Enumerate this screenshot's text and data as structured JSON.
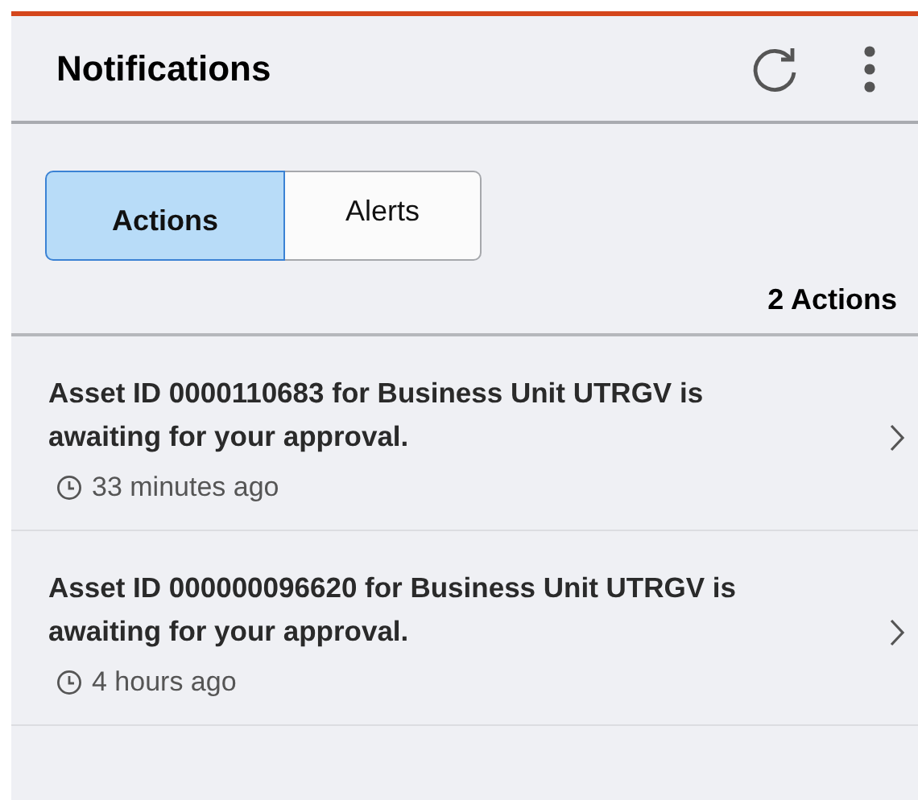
{
  "header": {
    "title": "Notifications"
  },
  "tabs": [
    {
      "label": "Actions",
      "selected": true
    },
    {
      "label": "Alerts",
      "selected": false
    }
  ],
  "count": "2 Actions",
  "notifications": [
    {
      "message": "Asset ID 0000110683 for Business Unit UTRGV is awaiting for your approval.",
      "time": "33 minutes ago"
    },
    {
      "message": "Asset ID 000000096620 for Business Unit UTRGV is awaiting for your approval.",
      "time": "4 hours ago"
    }
  ]
}
